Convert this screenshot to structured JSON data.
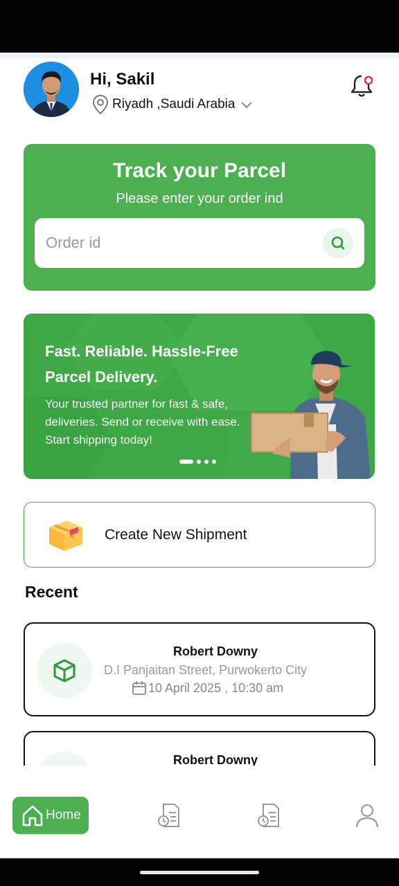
{
  "header": {
    "greeting": "Hi, Sakil",
    "location": "Riyadh ,Saudi Arabia"
  },
  "track": {
    "title": "Track your Parcel",
    "subtitle": "Please enter your order ind",
    "placeholder": "Order id"
  },
  "banner": {
    "title": "Fast. Reliable. Hassle-Free Parcel Delivery.",
    "text": "Your trusted partner for fast & safe,  deliveries. Send or receive with ease. Start shipping today!",
    "active_slide": 1,
    "slide_count": 4
  },
  "create_shipment": {
    "label": "Create New Shipment"
  },
  "recent": {
    "title": "Recent",
    "items": [
      {
        "name": "Robert Downy",
        "address": "D.I Panjaitan Street, Purwokerto City",
        "date": "10 April 2025 , 10:30 am"
      },
      {
        "name": "Robert Downy",
        "address": "",
        "date": ""
      }
    ]
  },
  "nav": {
    "home_label": "Home"
  },
  "colors": {
    "primary": "#4caf50",
    "accent_notification": "#e53935"
  }
}
